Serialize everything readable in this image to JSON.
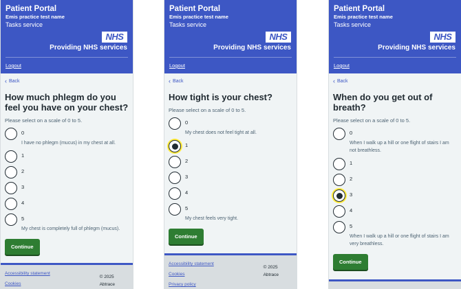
{
  "header": {
    "portal_title": "Patient Portal",
    "practice_name": "Emis practice test name",
    "service_name": "Tasks service",
    "logo_text": "NHS",
    "tagline": "Providing NHS services",
    "logout_label": "Logout"
  },
  "back_label": "Back",
  "continue_label": "Continue",
  "screens": [
    {
      "question": "How much phlegm do you feel you have on your chest?",
      "hint": "Please select on a scale of 0 to 5.",
      "options": [
        {
          "label": "0",
          "desc": "I have no phlegm (mucus) in my chest at all."
        },
        {
          "label": "1",
          "desc": ""
        },
        {
          "label": "2",
          "desc": ""
        },
        {
          "label": "3",
          "desc": ""
        },
        {
          "label": "4",
          "desc": ""
        },
        {
          "label": "5",
          "desc": "My chest is completely full of phlegm (mucus)."
        }
      ],
      "selected": null,
      "footer": {
        "links": [
          "Accessibility statement",
          "Cookies"
        ],
        "copyright": "© 2025",
        "company": "Abtrace"
      }
    },
    {
      "question": "How tight is your chest?",
      "hint": "Please select on a scale of 0 to 5.",
      "options": [
        {
          "label": "0",
          "desc": "My chest does not feel tight at all."
        },
        {
          "label": "1",
          "desc": ""
        },
        {
          "label": "2",
          "desc": ""
        },
        {
          "label": "3",
          "desc": ""
        },
        {
          "label": "4",
          "desc": ""
        },
        {
          "label": "5",
          "desc": "My chest feels very tight."
        }
      ],
      "selected": "1",
      "footer": {
        "links": [
          "Accessibility statement",
          "Cookies",
          "Privacy policy"
        ],
        "copyright": "© 2025",
        "company": "Abtrace"
      }
    },
    {
      "question": "When do you get out of breath?",
      "hint": "Please select on a scale of 0 to 5.",
      "options": [
        {
          "label": "0",
          "desc": "When I walk up a hill or one flight of stairs I am not breathless."
        },
        {
          "label": "1",
          "desc": ""
        },
        {
          "label": "2",
          "desc": ""
        },
        {
          "label": "3",
          "desc": ""
        },
        {
          "label": "4",
          "desc": ""
        },
        {
          "label": "5",
          "desc": "When I walk up a hill or one flight of stairs I am very breathless."
        }
      ],
      "selected": "3",
      "footer": {
        "links": [],
        "copyright": "",
        "company": ""
      }
    }
  ],
  "colors": {
    "nhs_blue": "#3d57c4",
    "button_green": "#2e7d32",
    "focus_yellow": "#ffeb3b",
    "page_bg": "#f0f4f5"
  }
}
